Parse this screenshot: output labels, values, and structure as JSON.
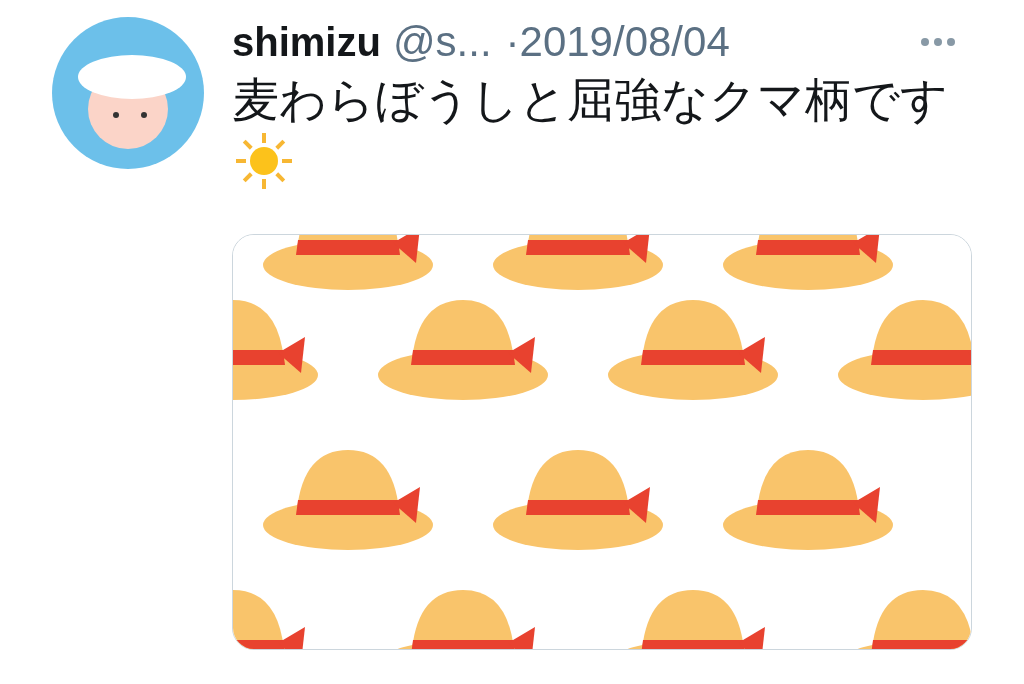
{
  "tweet": {
    "author": {
      "name": "shimizu",
      "handle": "@s..."
    },
    "date": "·2019/08/04",
    "text": "麦わらぼうしと屈強なクマ柄です"
  }
}
